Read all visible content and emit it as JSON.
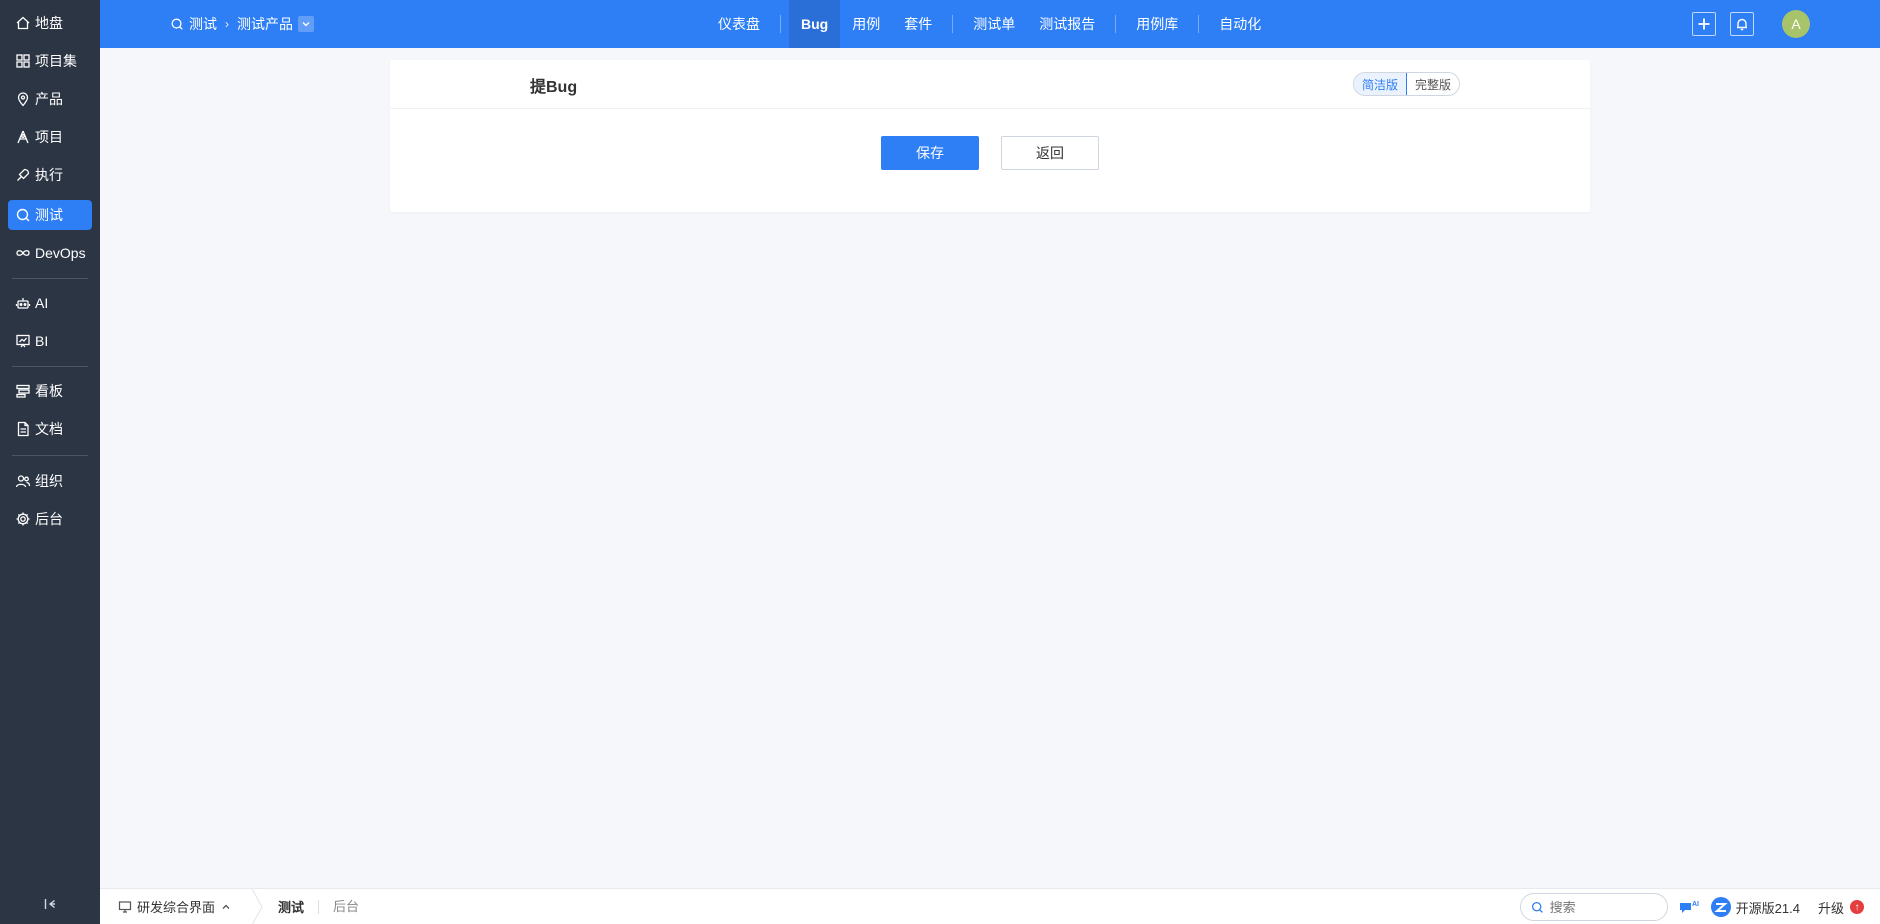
{
  "sidebar": {
    "items": [
      {
        "label": "地盘",
        "icon": "home-icon"
      },
      {
        "label": "项目集",
        "icon": "grid-icon"
      },
      {
        "label": "产品",
        "icon": "map-pin-icon"
      },
      {
        "label": "项目",
        "icon": "project-icon"
      },
      {
        "label": "执行",
        "icon": "rocket-icon"
      },
      {
        "label": "测试",
        "icon": "search-icon",
        "active": true
      },
      {
        "label": "DevOps",
        "icon": "infinity-icon"
      },
      {
        "label": "AI",
        "icon": "robot-icon"
      },
      {
        "label": "BI",
        "icon": "chart-board-icon"
      },
      {
        "label": "看板",
        "icon": "kanban-icon"
      },
      {
        "label": "文档",
        "icon": "document-icon"
      },
      {
        "label": "组织",
        "icon": "users-icon"
      },
      {
        "label": "后台",
        "icon": "gear-icon"
      }
    ]
  },
  "header": {
    "breadcrumb": {
      "module": "测试",
      "product": "测试产品"
    },
    "nav": [
      "仪表盘",
      "Bug",
      "用例",
      "套件",
      "测试单",
      "测试报告",
      "用例库",
      "自动化"
    ],
    "active_nav": "Bug",
    "avatar_initial": "A"
  },
  "panel": {
    "title": "提Bug",
    "modes": [
      "简洁版",
      "完整版"
    ],
    "active_mode": "简洁版",
    "save_label": "保存",
    "back_label": "返回"
  },
  "footer": {
    "menu_label": "研发综合界面",
    "crumbs": [
      "测试",
      "后台"
    ],
    "search_placeholder": "搜索",
    "version": "开源版21.4",
    "upgrade": "升级",
    "upgrade_badge": "↑"
  },
  "colors": {
    "primary": "#2e7ef5",
    "sidebar_bg": "#2b3544",
    "page_bg": "#f5f7fa"
  }
}
